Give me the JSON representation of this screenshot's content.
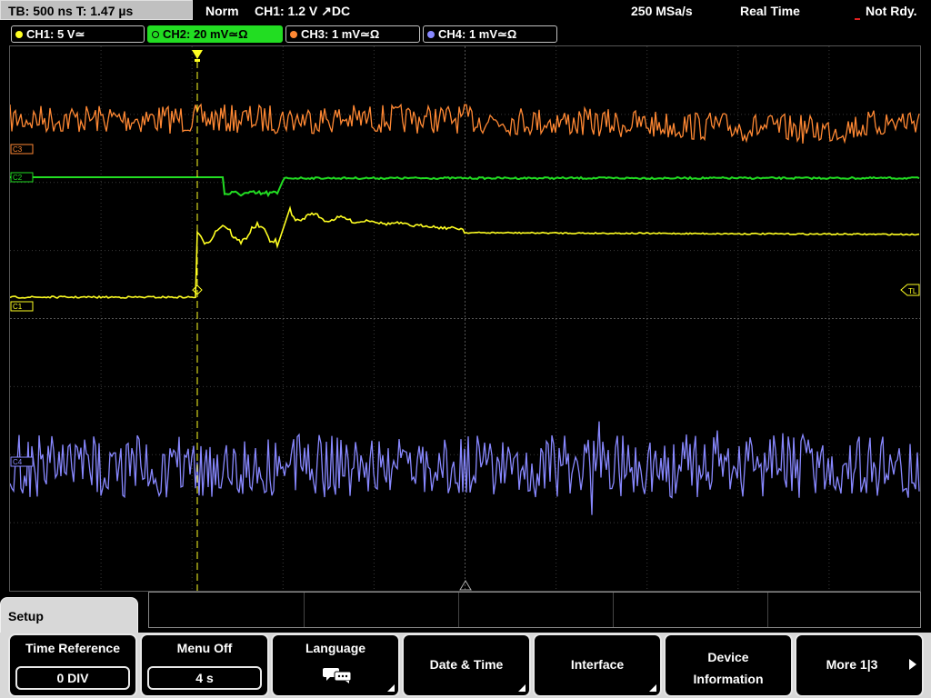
{
  "status": {
    "timebase": "TB: 500 ns   T: 1.47 µs",
    "trigger_mode": "Norm",
    "trigger_info": "CH1: 1.2 V ↗DC",
    "sample_rate": "250 MSa/s",
    "acq_mode": "Real Time",
    "trigger_state": "Not Rdy."
  },
  "channels": [
    {
      "label": "CH1: 5 V≃",
      "color": "#ffff22"
    },
    {
      "label": "CH2: 20 mV≃Ω",
      "color": "#22dd22"
    },
    {
      "label": "CH3: 1 mV≃Ω",
      "color": "#ff8833"
    },
    {
      "label": "CH4: 1 mV≃Ω",
      "color": "#8888ff"
    }
  ],
  "markers": {
    "ch1": "C1",
    "ch2": "C2",
    "ch3": "C3",
    "ch4": "C4",
    "trigger_level": "TL"
  },
  "menu": {
    "title": "Setup",
    "softkeys": [
      {
        "label": "Time Reference",
        "value": "0 DIV"
      },
      {
        "label": "Menu Off",
        "value": "4 s"
      },
      {
        "label": "Language",
        "icon": "speech-bubbles-icon"
      },
      {
        "label": "Date & Time"
      },
      {
        "label": "Interface"
      },
      {
        "label_line1": "Device",
        "label_line2": "Information"
      },
      {
        "label": "More 1|3"
      }
    ]
  },
  "colors": {
    "ch1": "#ffff22",
    "ch2": "#22dd22",
    "ch3": "#ff8833",
    "ch4": "#8888ff",
    "grid": "#3a3a3a",
    "softkey_bg": "#d8d8d8"
  }
}
